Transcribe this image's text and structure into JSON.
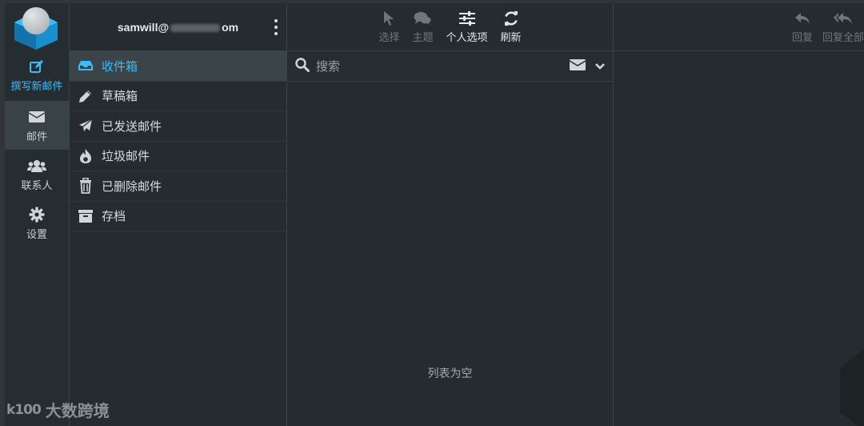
{
  "rail": {
    "compose_label": "撰写新邮件",
    "mail_label": "邮件",
    "contacts_label": "联系人",
    "settings_label": "设置"
  },
  "account": {
    "email_prefix": "samwill@",
    "email_suffix": "om"
  },
  "folders": [
    {
      "label": "收件箱",
      "icon": "inbox-icon"
    },
    {
      "label": "草稿箱",
      "icon": "pencil-icon"
    },
    {
      "label": "已发送邮件",
      "icon": "paper-plane-icon"
    },
    {
      "label": "垃圾邮件",
      "icon": "fire-icon"
    },
    {
      "label": "已删除邮件",
      "icon": "trash-icon"
    },
    {
      "label": "存档",
      "icon": "archive-icon"
    }
  ],
  "toolbar": {
    "select_label": "选择",
    "thread_label": "主题",
    "options_label": "个人选项",
    "refresh_label": "刷新"
  },
  "search": {
    "placeholder": "搜索"
  },
  "list": {
    "empty_text": "列表为空"
  },
  "preview_toolbar": {
    "reply_label": "回复",
    "reply_all_label": "回复全部"
  },
  "watermark": {
    "logo_text": "k100",
    "text": "大数跨境"
  },
  "colors": {
    "accent": "#37beff",
    "background": "#252b2e",
    "active_row": "#3b4448"
  }
}
